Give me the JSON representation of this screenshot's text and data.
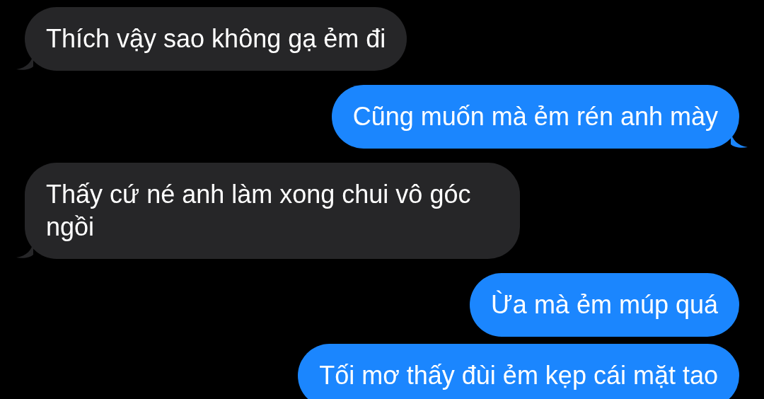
{
  "messages": [
    {
      "kind": "incoming",
      "text": "Thích vậy sao không gạ ẻm đi",
      "tail": true
    },
    {
      "kind": "outgoing",
      "text": "Cũng muốn mà ẻm rén anh mày",
      "tail": true
    },
    {
      "kind": "incoming",
      "text": "Thấy cứ né anh làm xong chui vô góc ngồi",
      "tail": true
    },
    {
      "kind": "outgoing",
      "text": "Ừa mà ẻm múp quá",
      "tail": false
    },
    {
      "kind": "outgoing",
      "text": "Tối mơ thấy đùi ẻm kẹp cái mặt tao",
      "tail": false
    }
  ]
}
